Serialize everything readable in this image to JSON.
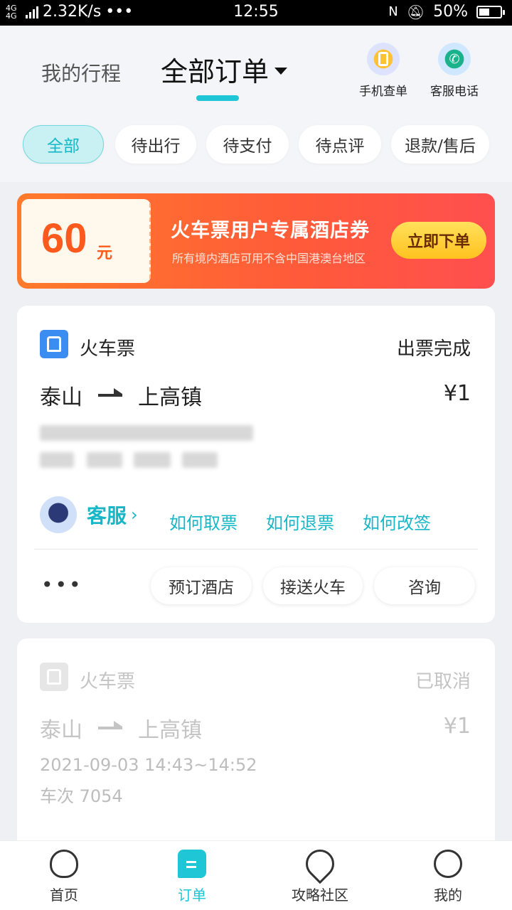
{
  "status_bar": {
    "network": "4G 4G",
    "speed": "2.32K/s",
    "dots": "•••",
    "time": "12:55",
    "battery": "50%",
    "battery_level": 0.5
  },
  "header": {
    "tab_trip": "我的行程",
    "tab_orders": "全部订单",
    "action_phone_query": "手机查单",
    "action_service_call": "客服电话"
  },
  "filters": [
    "全部",
    "待出行",
    "待支付",
    "待点评",
    "退款/售后"
  ],
  "banner": {
    "amount": "60",
    "unit": "元",
    "title": "火车票用户专属酒店券",
    "subtitle": "所有境内酒店可用不含中国港澳台地区",
    "button": "立即下单"
  },
  "orders": [
    {
      "type": "火车票",
      "status": "出票完成",
      "from": "泰山",
      "to": "上高镇",
      "price": "¥1",
      "service": {
        "label": "客服",
        "chevron": "›",
        "links": [
          "如何取票",
          "如何退票",
          "如何改签"
        ]
      },
      "more": "•••",
      "actions": [
        "预订酒店",
        "接送火车",
        "咨询"
      ]
    },
    {
      "type": "火车票",
      "status": "已取消",
      "from": "泰山",
      "to": "上高镇",
      "price": "¥1",
      "time": "2021-09-03 14:43~14:52",
      "train_no": "车次 7054"
    }
  ],
  "bottom_nav": [
    "首页",
    "订单",
    "攻略社区",
    "我的"
  ],
  "colors": {
    "accent": "#1ec6d6",
    "banner_start": "#ff7a2a",
    "banner_end": "#ff4f4f",
    "train_blue": "#3b8df2"
  }
}
